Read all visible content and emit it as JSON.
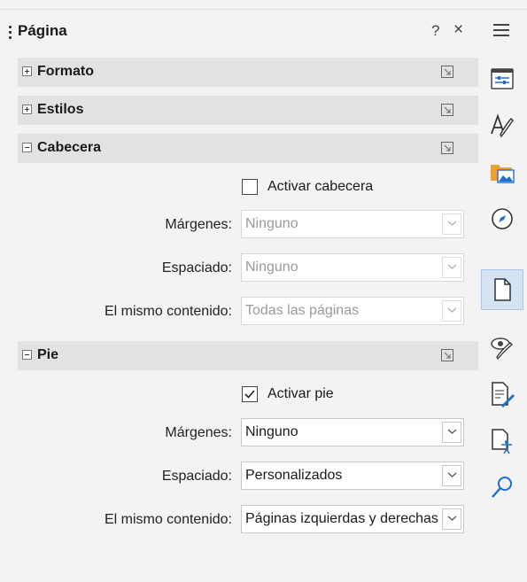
{
  "panel": {
    "title": "Página",
    "help": "?",
    "close": "×"
  },
  "sections": {
    "formato": {
      "label": "Formato"
    },
    "estilos": {
      "label": "Estilos"
    },
    "cabecera": {
      "label": "Cabecera",
      "enable_label": "Activar cabecera",
      "enabled": false,
      "margins_label": "Márgenes:",
      "margins_value": "Ninguno",
      "spacing_label": "Espaciado:",
      "spacing_value": "Ninguno",
      "same_content_label": "El mismo contenido:",
      "same_content_value": "Todas las páginas"
    },
    "pie": {
      "label": "Pie",
      "enable_label": "Activar pie",
      "enabled": true,
      "margins_label": "Márgenes:",
      "margins_value": "Ninguno",
      "spacing_label": "Espaciado:",
      "spacing_value": "Personalizados",
      "same_content_label": "El mismo contenido:",
      "same_content_value": "Páginas izquierdas y derechas"
    }
  },
  "sidebar_tabs": [
    {
      "icon": "menu-icon"
    },
    {
      "icon": "properties-icon"
    },
    {
      "icon": "styles-icon"
    },
    {
      "icon": "gallery-icon"
    },
    {
      "icon": "navigator-icon"
    },
    {
      "icon": "page-icon",
      "active": true
    },
    {
      "icon": "style-inspector-icon"
    },
    {
      "icon": "manage-changes-icon"
    },
    {
      "icon": "accessibility-check-icon"
    },
    {
      "icon": "find-icon"
    }
  ],
  "colors": {
    "accent": "#1e6fd0",
    "active_tab_bg": "#d5e4f3",
    "section_bg": "#e2e2e2",
    "gallery_orange": "#f0a030"
  }
}
